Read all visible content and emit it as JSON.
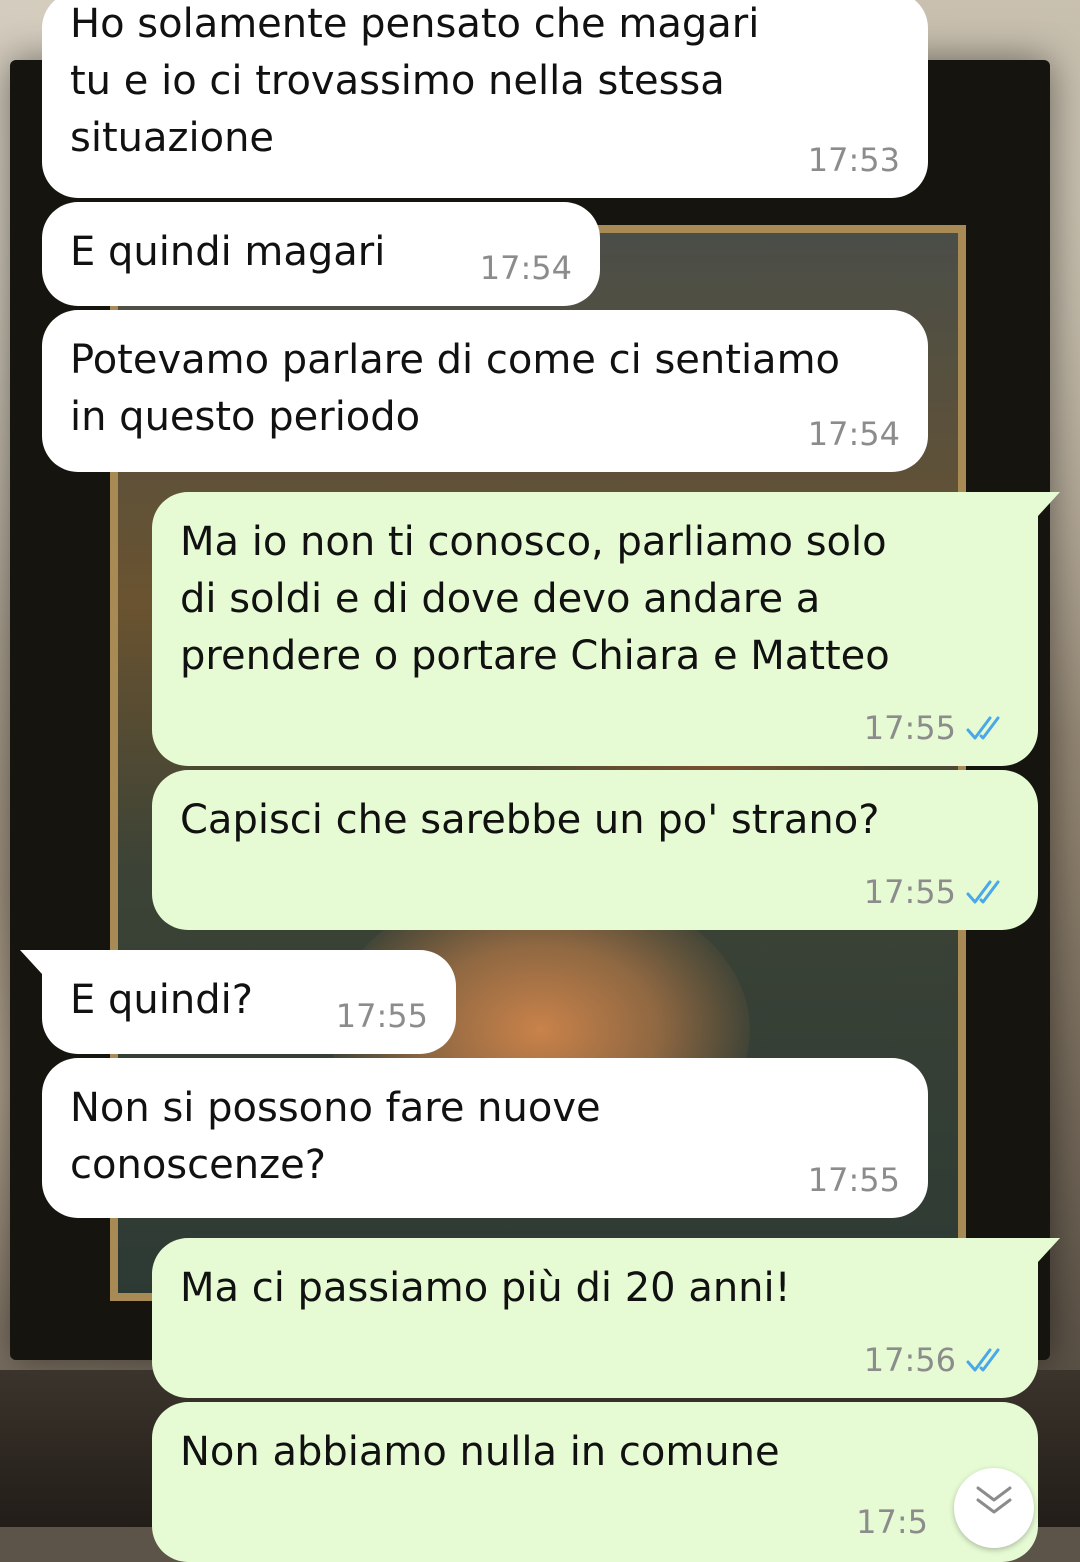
{
  "colors": {
    "incoming_bubble": "#ffffff",
    "outgoing_bubble": "#e6fbd4",
    "read_ticks": "#4aa8e8",
    "timestamp": "#8c8c8c"
  },
  "messages": [
    {
      "direction": "incoming",
      "text": "Ho solamente pensato che magari\ntu e io ci trovassimo nella stessa\nsituazione",
      "time": "17:53"
    },
    {
      "direction": "incoming",
      "text": "E quindi magari",
      "time": "17:54"
    },
    {
      "direction": "incoming",
      "text": "Potevamo parlare di come ci sentiamo\nin questo periodo",
      "time": "17:54"
    },
    {
      "direction": "outgoing",
      "text": "Ma io non ti conosco, parliamo solo\ndi soldi e di dove devo andare a\nprendere o portare Chiara e Matteo",
      "time": "17:55",
      "status": "read"
    },
    {
      "direction": "outgoing",
      "text": "Capisci che sarebbe un po' strano?",
      "time": "17:55",
      "status": "read"
    },
    {
      "direction": "incoming",
      "text": "E quindi?",
      "time": "17:55"
    },
    {
      "direction": "incoming",
      "text": "Non si possono fare nuove\nconoscenze?",
      "time": "17:55"
    },
    {
      "direction": "outgoing",
      "text": "Ma ci passiamo più di 20 anni!",
      "time": "17:56",
      "status": "read"
    },
    {
      "direction": "outgoing",
      "text": "Non abbiamo nulla in comune",
      "time": "17:5",
      "status": "read"
    }
  ],
  "scroll_button": {
    "icon": "double-chevron-down-icon"
  }
}
